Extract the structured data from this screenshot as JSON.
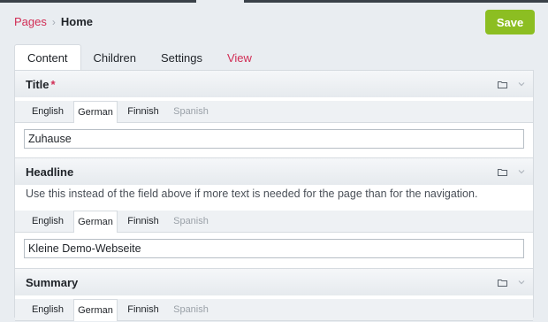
{
  "breadcrumb": {
    "parent": "Pages",
    "separator": "›",
    "current": "Home"
  },
  "header": {
    "save_label": "Save"
  },
  "page_tabs": [
    {
      "label": "Content",
      "active": true
    },
    {
      "label": "Children"
    },
    {
      "label": "Settings"
    },
    {
      "label": "View"
    }
  ],
  "languages": [
    "English",
    "German",
    "Finnish",
    "Spanish"
  ],
  "active_language": "German",
  "fields": {
    "title": {
      "label": "Title",
      "required_mark": "*",
      "value": "Zuhause"
    },
    "headline": {
      "label": "Headline",
      "description": "Use this instead of the field above if more text is needed for the page than for the navigation.",
      "value": "Kleine Demo-Webseite"
    },
    "summary": {
      "label": "Summary"
    }
  },
  "colors": {
    "accent": "#d12d55",
    "save": "#8cbe22",
    "topbar": "#3a4149"
  }
}
